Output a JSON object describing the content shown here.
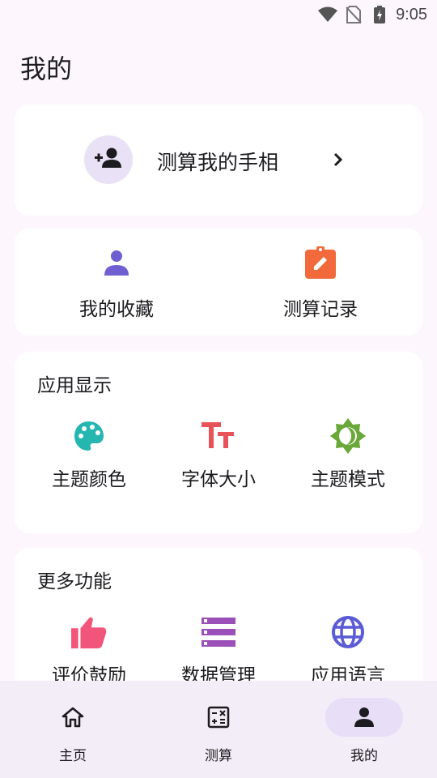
{
  "status_bar": {
    "time": "9:05",
    "icons": [
      "wifi-icon",
      "no-sim-icon",
      "battery-charging-icon"
    ]
  },
  "page": {
    "title": "我的"
  },
  "profile_card": {
    "label": "测算我的手相",
    "icon": "add-person-icon",
    "chevron": "chevron-right-icon"
  },
  "quick_actions": [
    {
      "label": "我的收藏",
      "icon": "person-icon",
      "color": "#6f5fd1"
    },
    {
      "label": "测算记录",
      "icon": "clipboard-edit-icon",
      "color": "#f26a3c"
    }
  ],
  "display_section": {
    "title": "应用显示",
    "items": [
      {
        "label": "主题颜色",
        "icon": "palette-icon",
        "color": "#26b6b0"
      },
      {
        "label": "字体大小",
        "icon": "text-size-icon",
        "color": "#e8535a"
      },
      {
        "label": "主题模式",
        "icon": "brightness-icon",
        "color": "#6aa83a"
      }
    ]
  },
  "more_section": {
    "title": "更多功能",
    "items": [
      {
        "label": "评价鼓励",
        "icon": "thumbs-up-icon",
        "color": "#f2557a"
      },
      {
        "label": "数据管理",
        "icon": "storage-icon",
        "color": "#9b4fb8"
      },
      {
        "label": "应用语言",
        "icon": "globe-icon",
        "color": "#5b5bd6"
      }
    ]
  },
  "bottom_nav": {
    "items": [
      {
        "label": "主页",
        "icon": "home-icon",
        "active": false
      },
      {
        "label": "测算",
        "icon": "calculator-icon",
        "active": false
      },
      {
        "label": "我的",
        "icon": "person-icon",
        "active": true
      }
    ]
  }
}
